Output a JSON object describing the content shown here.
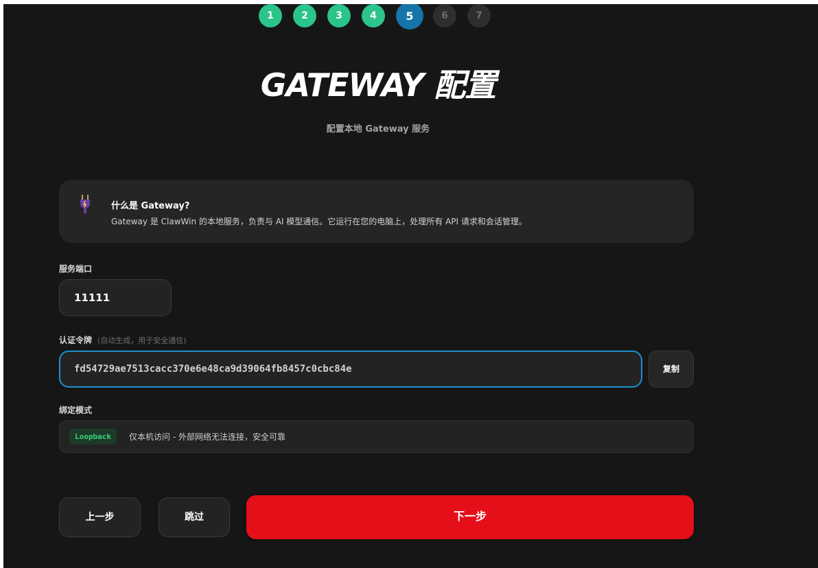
{
  "stepper": {
    "steps": [
      {
        "label": "1",
        "state": "done"
      },
      {
        "label": "2",
        "state": "done"
      },
      {
        "label": "3",
        "state": "done"
      },
      {
        "label": "4",
        "state": "done"
      },
      {
        "label": "5",
        "state": "current"
      },
      {
        "label": "6",
        "state": "todo"
      },
      {
        "label": "7",
        "state": "todo"
      }
    ]
  },
  "header": {
    "title": "GATEWAY 配置",
    "subtitle": "配置本地 Gateway 服务"
  },
  "info": {
    "icon": "plug-icon",
    "title": "什么是 Gateway?",
    "text": "Gateway 是 ClawWin 的本地服务，负责与 AI 模型通信。它运行在您的电脑上，处理所有 API 请求和会话管理。"
  },
  "port": {
    "label": "服务端口",
    "value": "11111"
  },
  "token": {
    "label": "认证令牌",
    "hint": "(自动生成，用于安全通信)",
    "value": "fd54729ae7513cacc370e6e48ca9d39064fb8457c0cbc84e",
    "copy_label": "复制"
  },
  "bind": {
    "label": "绑定模式",
    "badge": "Loopback",
    "description": "仅本机访问 - 外部网络无法连接，安全可靠"
  },
  "actions": {
    "back_label": "上一步",
    "skip_label": "跳过",
    "next_label": "下一步"
  },
  "colors": {
    "background": "#161616",
    "step_done": "#2bc48a",
    "step_current": "#1674a8",
    "focus_border": "#1f8fd0",
    "primary_button": "#e50f1a",
    "badge_text": "#3fd07e"
  }
}
